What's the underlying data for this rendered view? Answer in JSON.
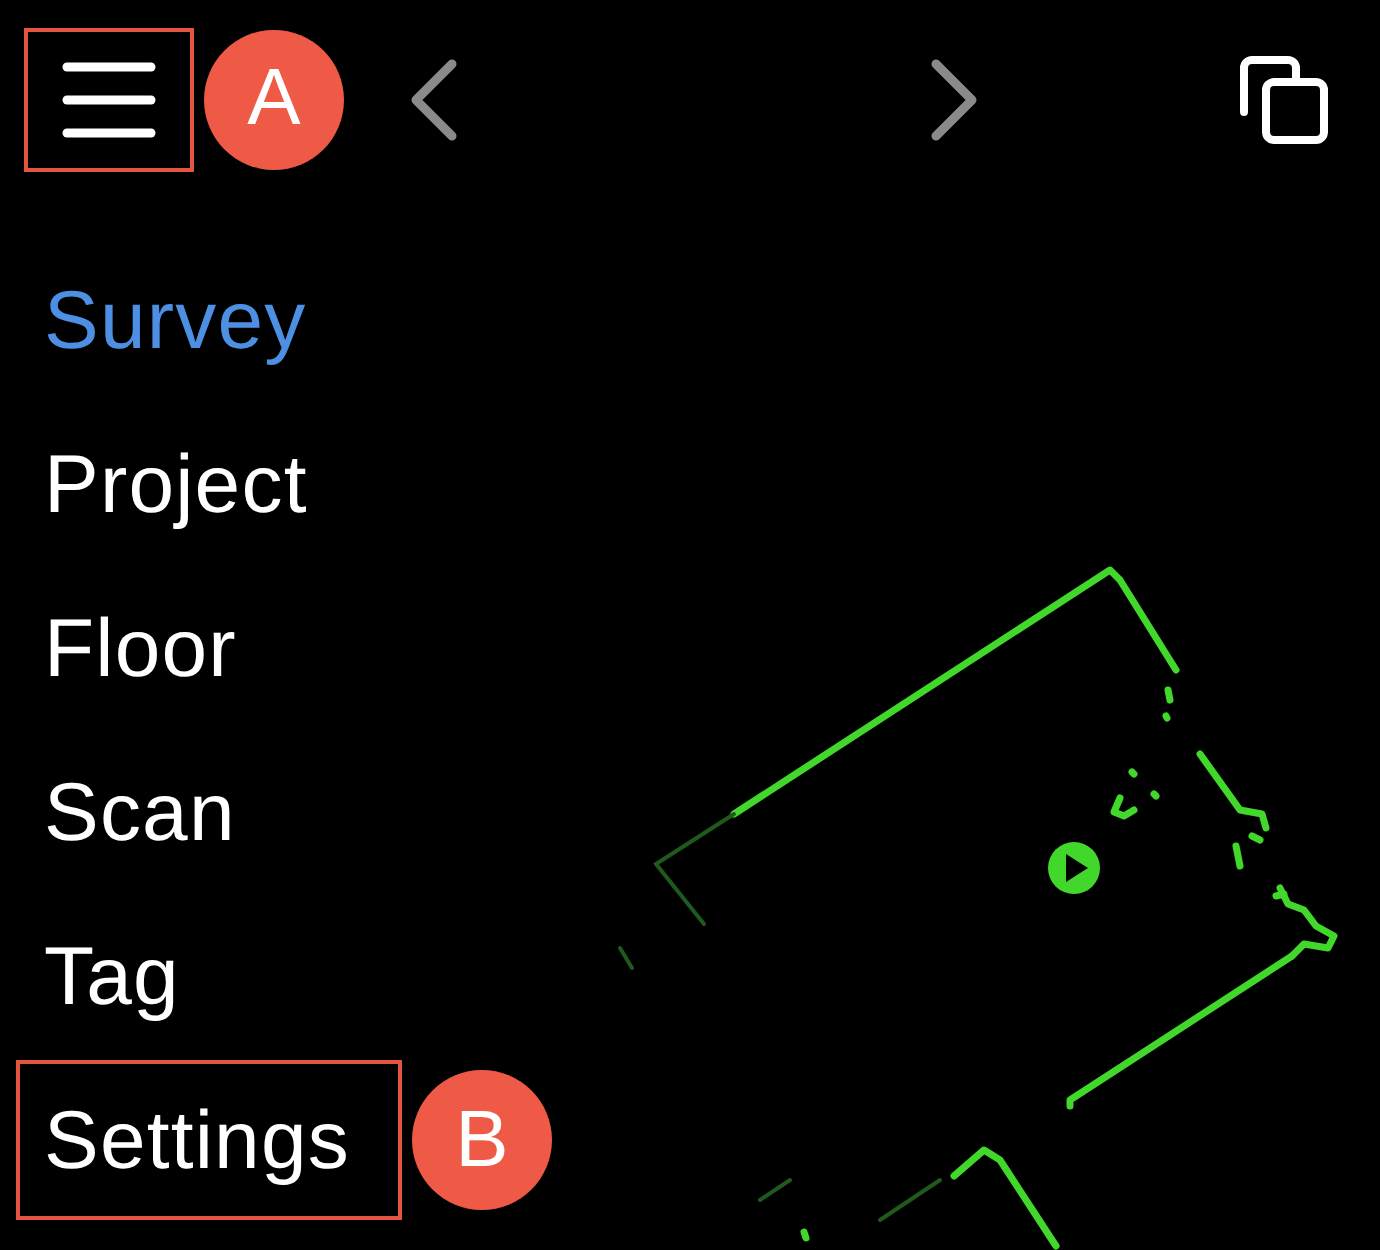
{
  "toolbar": {
    "menu_button": {
      "highlighted": true,
      "callout": "A"
    }
  },
  "menu": {
    "items": [
      {
        "label": "Survey",
        "selected": true,
        "highlighted": false
      },
      {
        "label": "Project",
        "selected": false,
        "highlighted": false
      },
      {
        "label": "Floor",
        "selected": false,
        "highlighted": false
      },
      {
        "label": "Scan",
        "selected": false,
        "highlighted": false
      },
      {
        "label": "Tag",
        "selected": false,
        "highlighted": false
      },
      {
        "label": "Settings",
        "selected": false,
        "highlighted": true,
        "callout": "B"
      }
    ]
  }
}
